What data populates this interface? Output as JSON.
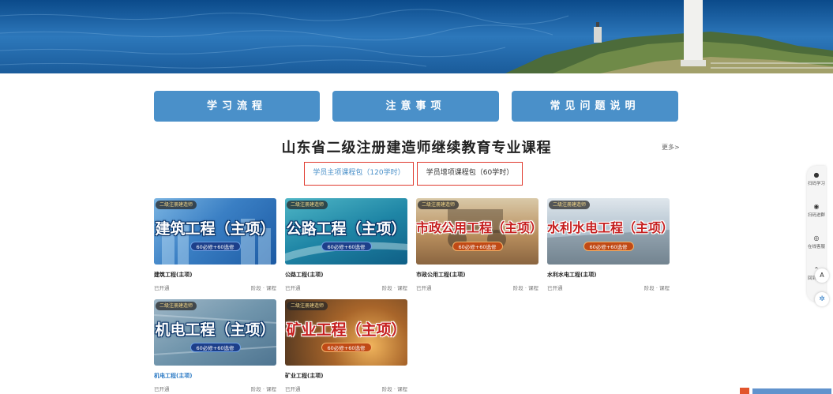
{
  "nav": {
    "learning_flow": "学习流程",
    "notes": "注意事项",
    "faq": "常见问题说明"
  },
  "section": {
    "title": "山东省二级注册建造师继续教育专业课程",
    "more": "更多>"
  },
  "packages": {
    "main": "学员主项课程包（120学时）",
    "extra": "学员增项课程包（60学时）"
  },
  "courses": [
    {
      "tag": "二级注册建造师",
      "big": "建筑工程（主项）",
      "pill": "60必修+60选修",
      "name": "建筑工程(主项)",
      "status": "已开通",
      "meta": "阶段 · 课程"
    },
    {
      "tag": "二级注册建造师",
      "big": "公路工程（主项）",
      "pill": "60必修+60选修",
      "name": "公路工程(主项)",
      "status": "已开通",
      "meta": "阶段 · 课程"
    },
    {
      "tag": "二级注册建造师",
      "big": "市政公用工程（主项）",
      "pill": "60必修+60选修",
      "name": "市政公用工程(主项)",
      "status": "已开通",
      "meta": "阶段 · 课程"
    },
    {
      "tag": "二级注册建造师",
      "big": "水利水电工程（主项）",
      "pill": "60必修+60选修",
      "name": "水利水电工程(主项)",
      "status": "已开通",
      "meta": "阶段 · 课程"
    },
    {
      "tag": "二级注册建造师",
      "big": "机电工程（主项）",
      "pill": "60必修+60选修",
      "name": "机电工程(主项)",
      "status": "已开通",
      "meta": "阶段 · 课程"
    },
    {
      "tag": "二级注册建造师",
      "big": "矿业工程（主项）",
      "pill": "60必修+60选修",
      "name": "矿业工程(主项)",
      "status": "已开通",
      "meta": "阶段 · 课程"
    }
  ],
  "sidebar": {
    "scan_study": "扫码学习",
    "scan_progress": "扫码进群",
    "online_report": "在线客服",
    "back": "回到顶部"
  },
  "colors": {
    "nav_button": "#4a90c9",
    "highlight_border": "#e03a2e",
    "active_tab_text": "#4a90c9"
  }
}
